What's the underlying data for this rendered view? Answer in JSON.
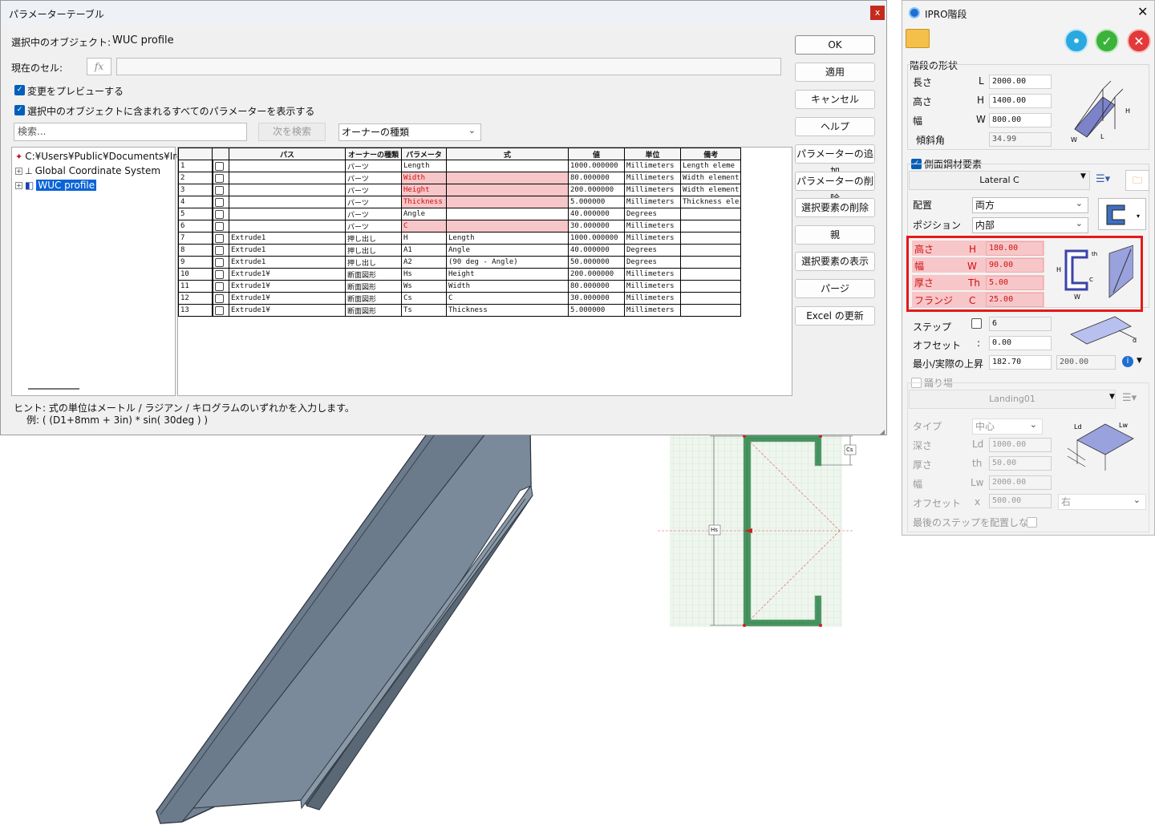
{
  "param_window": {
    "title": "パラメーターテーブル",
    "close_glyph": "x",
    "selected_object_label": "選択中のオブジェクト:",
    "selected_object_value": "WUC profile",
    "current_cell_label": "現在のセル:",
    "fx_label": "fx",
    "preview_label": "変更をプレビューする",
    "show_all_label": "選択中のオブジェクトに含まれるすべてのパラメーターを表示する",
    "search_placeholder": "検索...",
    "find_next_label": "次を検索",
    "owner_type_select": "オーナーの種類",
    "buttons": {
      "ok": "OK",
      "apply": "適用",
      "cancel": "キャンセル",
      "help": "ヘルプ",
      "add_param": "パラメーターの追加",
      "delete_param": "パラメーターの削除",
      "delete_selection": "選択要素の削除",
      "parent": "親",
      "show_selection": "選択要素の表示",
      "purge": "パージ",
      "excel_update": "Excel の更新"
    },
    "tree": {
      "root": "C:¥Users¥Public¥Documents¥Iron",
      "items": [
        "Global Coordinate System",
        "WUC profile"
      ]
    },
    "hint_line1": "ヒント: 式の単位はメートル / ラジアン / キログラムのいずれかを入力します。",
    "hint_line2": "例: ( (D1+8mm + 3in) * sin( 30deg ) )",
    "grid": {
      "headers": [
        "",
        "",
        "パス",
        "オーナーの種類",
        "パラメータ",
        "式",
        "値",
        "単位",
        "備考"
      ],
      "rows": [
        [
          "1",
          "",
          "パーツ",
          "Length",
          "",
          "1000.000000",
          "Millimeters",
          "Length eleme"
        ],
        [
          "2",
          "",
          "パーツ",
          "Width",
          "",
          "80.000000",
          "Millimeters",
          "Width element"
        ],
        [
          "3",
          "",
          "パーツ",
          "Height",
          "",
          "200.000000",
          "Millimeters",
          "Width element"
        ],
        [
          "4",
          "",
          "パーツ",
          "Thickness",
          "",
          "5.000000",
          "Millimeters",
          "Thickness ele"
        ],
        [
          "5",
          "",
          "パーツ",
          "Angle",
          "",
          "40.000000",
          "Degrees",
          ""
        ],
        [
          "6",
          "",
          "パーツ",
          "C",
          "",
          "30.000000",
          "Millimeters",
          ""
        ],
        [
          "7",
          "Extrude1",
          "押し出し",
          "H",
          "Length",
          "1000.000000",
          "Millimeters",
          ""
        ],
        [
          "8",
          "Extrude1",
          "押し出し",
          "A1",
          "Angle",
          "40.000000",
          "Degrees",
          ""
        ],
        [
          "9",
          "Extrude1",
          "押し出し",
          "A2",
          "(90 deg - Angle)",
          "50.000000",
          "Degrees",
          ""
        ],
        [
          "10",
          "Extrude1¥",
          "断面図形",
          "Hs",
          "Height",
          "200.000000",
          "Millimeters",
          ""
        ],
        [
          "11",
          "Extrude1¥",
          "断面図形",
          "Ws",
          "Width",
          "80.000000",
          "Millimeters",
          ""
        ],
        [
          "12",
          "Extrude1¥",
          "断面図形",
          "Cs",
          "C",
          "30.000000",
          "Millimeters",
          ""
        ],
        [
          "13",
          "Extrude1¥",
          "断面図形",
          "Ts",
          "Thickness",
          "5.000000",
          "Millimeters",
          ""
        ]
      ],
      "highlighted_rows": [
        2,
        3,
        4,
        6
      ]
    }
  },
  "sketch": {
    "dim_ws": "Ws",
    "dim_hs": "Hs",
    "dim_cs": "Cs"
  },
  "ipro": {
    "title": "IPRO階段",
    "stair_shape_label": "階段の形状",
    "length_label": "長さ",
    "length_sym": "L",
    "length_val": "2000.00",
    "height_label": "高さ",
    "height_sym": "H",
    "height_val": "1400.00",
    "width_label": "幅",
    "width_sym": "W",
    "width_val": "800.00",
    "incline_label": "傾斜角",
    "incline_val": "34.99",
    "side_member_label": "側面鋼材要素",
    "profile_select": "Lateral C",
    "placement_label": "配置",
    "placement_val": "両方",
    "position_label": "ポジション",
    "position_val": "内部",
    "prof_height_label": "高さ",
    "prof_height_sym": "H",
    "prof_height_val": "180.00",
    "prof_width_label": "幅",
    "prof_width_sym": "W",
    "prof_width_val": "90.00",
    "prof_thick_label": "厚さ",
    "prof_thick_sym": "Th",
    "prof_thick_val": "5.00",
    "prof_flange_label": "フランジ",
    "prof_flange_sym": "C",
    "prof_flange_val": "25.00",
    "step_label": "ステップ",
    "step_val": "6",
    "offset_label": "オフセット",
    "offset_sym": ":",
    "offset_val": "0.00",
    "rise_label": "最小/実際の上昇",
    "rise_min": "182.70",
    "rise_actual": "200.00",
    "landing_label": "踊り場",
    "landing_select": "Landing01",
    "type_label": "タイプ",
    "type_val": "中心",
    "depth_label": "深さ",
    "depth_sym": "Ld",
    "depth_val": "1000.00",
    "thick_label": "厚さ",
    "thick_sym": "th",
    "thick_val": "50.00",
    "lwidth_label": "幅",
    "lwidth_sym": "Lw",
    "lwidth_val": "2000.00",
    "loffset_label": "オフセット",
    "loffset_sym": "x",
    "loffset_val": "500.00",
    "loffset_dir": "右",
    "no_last_step_label": "最後のステップを配置しない",
    "colors": {
      "ok": "#3bb33b",
      "cancel": "#e23a3a",
      "info": "#29a9e0"
    }
  }
}
